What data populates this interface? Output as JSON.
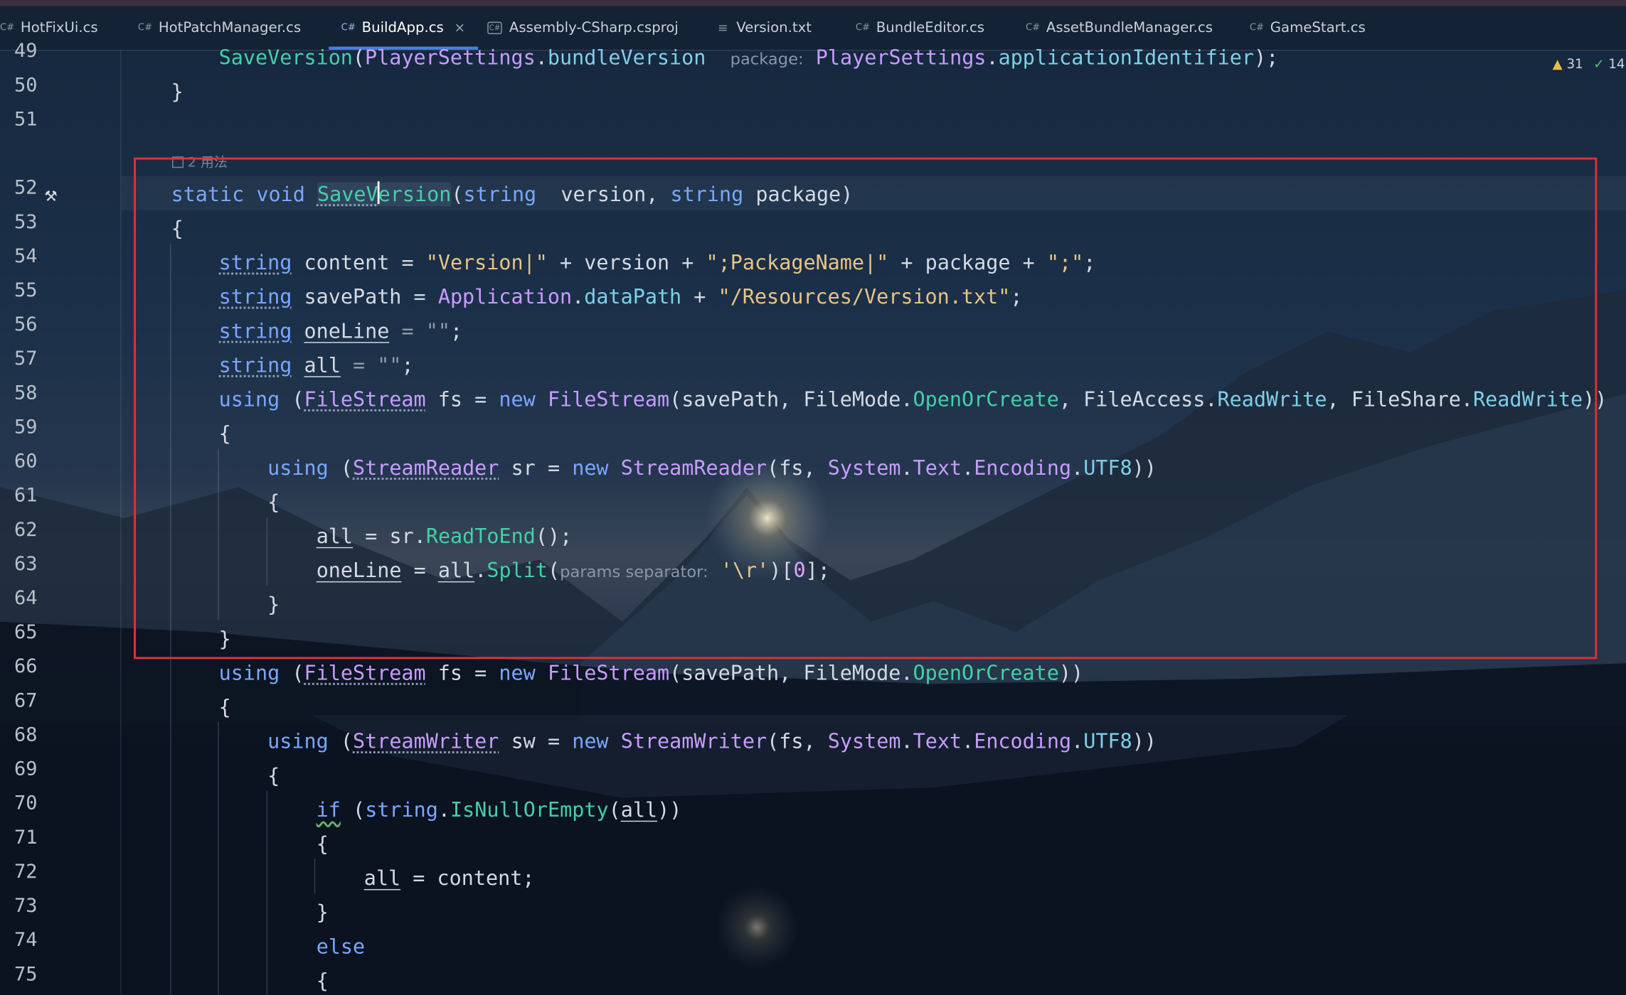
{
  "tabs": [
    {
      "icon": "C#",
      "label": "HotFixUi.cs"
    },
    {
      "icon": "C#",
      "label": "HotPatchManager.cs"
    },
    {
      "icon": "C#",
      "label": "BuildApp.cs",
      "close": "×"
    },
    {
      "icon": "C#",
      "label": "Assembly-CSharp.csproj"
    },
    {
      "icon": "≡",
      "label": "Version.txt"
    },
    {
      "icon": "C#",
      "label": "BundleEditor.cs"
    },
    {
      "icon": "C#",
      "label": "AssetBundleManager.cs"
    },
    {
      "icon": "C#",
      "label": "GameStart.cs"
    }
  ],
  "inspection": {
    "warnings": "31",
    "ok": "14",
    "warn_icon": "warning-triangle",
    "ok_icon": "check-mark"
  },
  "usage_hint": "2 用法",
  "line_numbers": [
    "49",
    "50",
    "51",
    "52",
    "53",
    "54",
    "55",
    "56",
    "57",
    "58",
    "59",
    "60",
    "61",
    "62",
    "63",
    "64",
    "65",
    "66",
    "67",
    "68",
    "69",
    "70",
    "71",
    "72",
    "73",
    "74",
    "75"
  ],
  "code": {
    "l49": {
      "fn": "SaveVersion",
      "p1": "(",
      "c1": "PlayerSettings",
      "dot1": ".",
      "f1": "bundleVersion",
      "sep": ",",
      "hint": "package:",
      "c2": "PlayerSettings",
      "dot2": ".",
      "f2": "applicationIdentifier",
      "end": ");"
    },
    "l50": "}",
    "l52": {
      "kw1": "static",
      "kw2": "void",
      "name_a": "SaveV",
      "name_b": "ersion",
      "p": "(",
      "t1": "string",
      "a1": "version,",
      "t2": "string",
      "a2": "package)"
    },
    "l53": "{",
    "l54": {
      "t": "string",
      "v": "content",
      "eq": "=",
      "s1": "\"Version|\"",
      "op1": "+",
      "v2": "version",
      "op2": "+",
      "s2": "\";PackageName|\"",
      "op3": "+",
      "v3": "package",
      "op4": "+",
      "s3": "\";\"",
      "end": ";"
    },
    "l55": {
      "t": "string",
      "v": "savePath",
      "eq": "=",
      "c": "Application",
      "dot": ".",
      "f": "dataPath",
      "op": "+",
      "s": "\"/Resources/Version.txt\"",
      "end": ";"
    },
    "l56": {
      "t": "string",
      "v": "oneLine",
      "eq": "=",
      "s": "\"\"",
      "end": ";"
    },
    "l57": {
      "t": "string",
      "v": "all",
      "eq": "=",
      "s": "\"\"",
      "end": ";"
    },
    "l58": {
      "kw": "using",
      "p": "(",
      "c1": "FileStream",
      "v": "fs",
      "eq": "=",
      "kw2": "new",
      "c2": "FileStream",
      "a": "(savePath,",
      "c3": "FileMode",
      "dot1": ".",
      "f1": "OpenOrCreate",
      "sep1": ",",
      "c4": "FileAccess",
      "dot2": ".",
      "f2": "ReadWrite",
      "sep2": ",",
      "c5": "FileShare",
      "dot3": ".",
      "f3": "ReadWrite",
      "end": "))"
    },
    "l59": "{",
    "l60": {
      "kw": "using",
      "p": "(",
      "c1": "StreamReader",
      "v": "sr",
      "eq": "=",
      "kw2": "new",
      "c2": "StreamReader",
      "a": "(fs,",
      "c3": "System",
      "dot1": ".",
      "c4": "Text",
      "dot2": ".",
      "c5": "Encoding",
      "dot3": ".",
      "f": "UTF8",
      "end": "))"
    },
    "l61": "{",
    "l62": {
      "v": "all",
      "eq": "=",
      "o": "sr",
      "dot": ".",
      "m": "ReadToEnd",
      "end": "();"
    },
    "l63": {
      "v": "oneLine",
      "eq": "=",
      "o": "all",
      "dot": ".",
      "m": "Split",
      "p": "(",
      "hint": "params separator:",
      "s": "'\\r'",
      "close": ")[",
      "n": "0",
      "end": "];"
    },
    "l64": "}",
    "l65": "}",
    "l66": {
      "kw": "using",
      "p": "(",
      "c1": "FileStream",
      "v": "fs",
      "eq": "=",
      "kw2": "new",
      "c2": "FileStream",
      "a": "(savePath,",
      "c3": "FileMode",
      "dot": ".",
      "f": "OpenOrCreate",
      "end": "))"
    },
    "l67": "{",
    "l68": {
      "kw": "using",
      "p": "(",
      "c1": "StreamWriter",
      "v": "sw",
      "eq": "=",
      "kw2": "new",
      "c2": "StreamWriter",
      "a": "(fs,",
      "c3": "System",
      "dot1": ".",
      "c4": "Text",
      "dot2": ".",
      "c5": "Encoding",
      "dot3": ".",
      "f": "UTF8",
      "end": "))"
    },
    "l69": "{",
    "l70": {
      "kw": "if",
      "p": "(",
      "t": "string",
      "dot": ".",
      "m": "IsNullOrEmpty",
      "p2": "(",
      "v": "all",
      "end": "))"
    },
    "l71": "{",
    "l72": {
      "v": "all",
      "eq": "=",
      "v2": "content;"
    },
    "l73": "}",
    "l74": "else",
    "l75": "{"
  }
}
